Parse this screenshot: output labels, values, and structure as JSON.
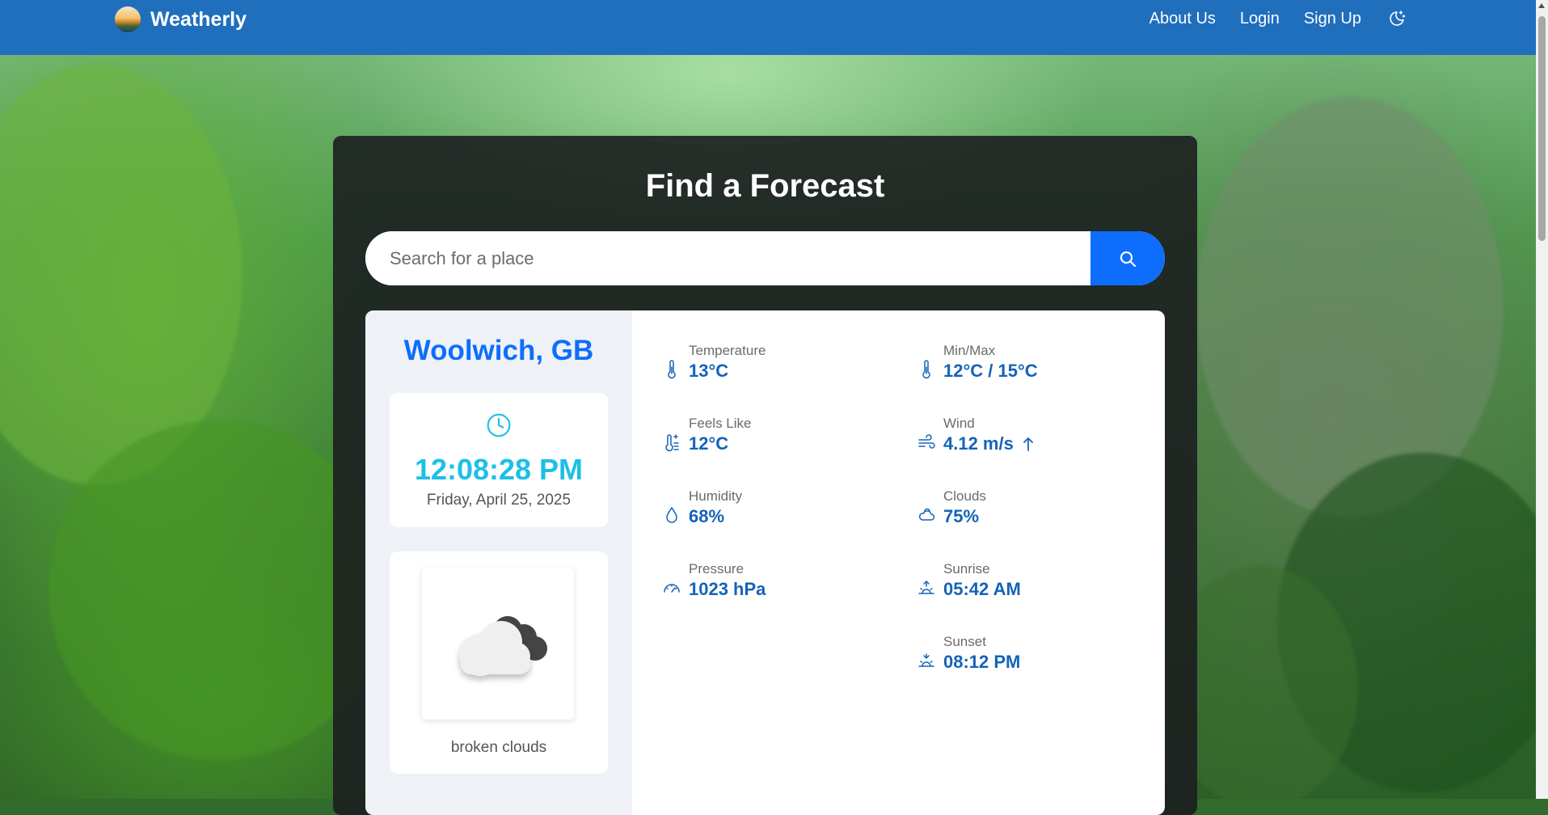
{
  "app": {
    "brand_name": "Weatherly"
  },
  "nav": {
    "links": [
      {
        "label": "About Us"
      },
      {
        "label": "Login"
      },
      {
        "label": "Sign Up"
      }
    ],
    "theme_toggle_icon": "moon-stars-icon"
  },
  "forecast": {
    "title": "Find a Forecast",
    "search": {
      "placeholder": "Search for a place",
      "value": "",
      "button_icon": "search-icon"
    }
  },
  "weather": {
    "location": "Woolwich, GB",
    "time": "12:08:28 PM",
    "date": "Friday, April 25, 2025",
    "condition": "broken clouds",
    "condition_icon": "broken-clouds-icon",
    "stats": [
      {
        "label": "Temperature",
        "value": "13°C",
        "icon": "thermometer-icon"
      },
      {
        "label": "Min/Max",
        "value": "12°C / 15°C",
        "icon": "thermometer-icon"
      },
      {
        "label": "Feels Like",
        "value": "12°C",
        "icon": "feels-like-icon"
      },
      {
        "label": "Wind",
        "value": "4.12 m/s",
        "icon": "wind-icon",
        "direction_icon": "arrow-up-icon"
      },
      {
        "label": "Humidity",
        "value": "68%",
        "icon": "droplet-icon"
      },
      {
        "label": "Clouds",
        "value": "75%",
        "icon": "cloud-icon"
      },
      {
        "label": "Pressure",
        "value": "1023 hPa",
        "icon": "gauge-icon"
      },
      {
        "label": "Sunrise",
        "value": "05:42 AM",
        "icon": "sunrise-icon"
      },
      {
        "label": "Sunset",
        "value": "08:12 PM",
        "icon": "sunset-icon"
      }
    ]
  },
  "colors": {
    "navbar": "#1f6fbd",
    "accent": "#0d6efd",
    "time": "#1cc0e6",
    "stat_value": "#1463b8"
  }
}
